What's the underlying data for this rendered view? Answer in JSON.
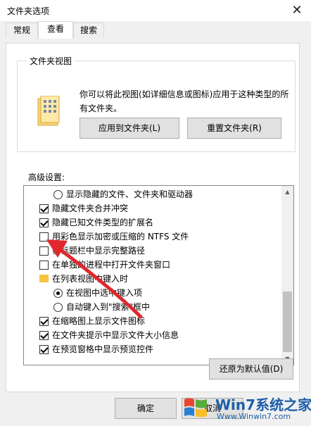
{
  "window": {
    "title": "文件夹选项",
    "close_glyph": "✕"
  },
  "tabs": [
    {
      "label": "常规",
      "active": false
    },
    {
      "label": "查看",
      "active": true
    },
    {
      "label": "搜索",
      "active": false
    }
  ],
  "folder_views": {
    "title": "文件夹视图",
    "description": "你可以将此视图(如详细信息或图标)应用于这种类型的所有文件夹。",
    "apply_button": "应用到文件夹(L)",
    "reset_button": "重置文件夹(R)"
  },
  "advanced": {
    "label": "高级设置:",
    "items": [
      {
        "type": "radio",
        "checked": false,
        "indent": 2,
        "label": "显示隐藏的文件、文件夹和驱动器"
      },
      {
        "type": "checkbox",
        "checked": true,
        "indent": 1,
        "label": "隐藏文件夹合并冲突"
      },
      {
        "type": "checkbox",
        "checked": true,
        "indent": 1,
        "label": "隐藏已知文件类型的扩展名"
      },
      {
        "type": "checkbox",
        "checked": false,
        "indent": 1,
        "label": "用彩色显示加密或压缩的 NTFS 文件"
      },
      {
        "type": "checkbox",
        "checked": false,
        "indent": 1,
        "label": "在标题栏中显示完整路径"
      },
      {
        "type": "checkbox",
        "checked": false,
        "indent": 1,
        "label": "在单独的进程中打开文件夹窗口"
      },
      {
        "type": "folder",
        "indent": 1,
        "label": "在列表视图中键入时"
      },
      {
        "type": "radio",
        "checked": true,
        "indent": 2,
        "label": "在视图中选中键入项"
      },
      {
        "type": "radio",
        "checked": false,
        "indent": 2,
        "label": "自动键入到\"搜索\"框中"
      },
      {
        "type": "checkbox",
        "checked": true,
        "indent": 1,
        "label": "在缩略图上显示文件图标"
      },
      {
        "type": "checkbox",
        "checked": true,
        "indent": 1,
        "label": "在文件夹提示中显示文件大小信息"
      },
      {
        "type": "checkbox",
        "checked": true,
        "indent": 1,
        "label": "在预览窗格中显示预览控件"
      }
    ],
    "restore_button": "还原为默认值(D)"
  },
  "footer": {
    "ok_button": "确定",
    "cancel_button": "取消"
  },
  "watermark": {
    "line1": "Win7系统之家",
    "line2": "Www.Winwin7.com"
  },
  "colors": {
    "annotation_arrow": "#e0282e",
    "folder": "#f5c542",
    "watermark": "#1e5fa8"
  }
}
